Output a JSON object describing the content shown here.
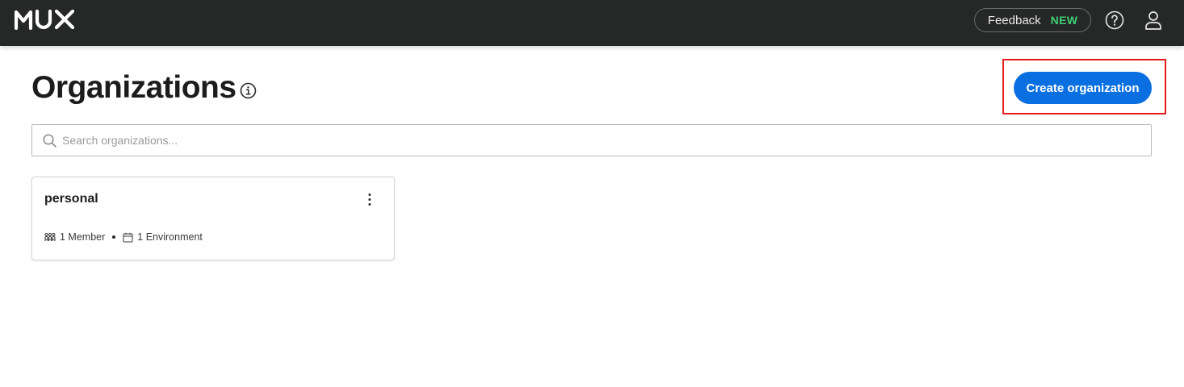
{
  "header": {
    "logo_text": "MUX",
    "feedback_label": "Feedback",
    "feedback_badge": "NEW"
  },
  "page": {
    "title": "Organizations",
    "create_button_label": "Create organization"
  },
  "search": {
    "placeholder": "Search organizations...",
    "value": ""
  },
  "organizations": [
    {
      "name": "personal",
      "members": "1 Member",
      "environments": "1 Environment"
    }
  ],
  "colors": {
    "topbar_bg": "#262727",
    "accent_blue": "#0a6fe0",
    "badge_green": "#3fcf74",
    "highlight_red": "#e31b1b"
  },
  "icons": {
    "help": "question-circle-icon",
    "user": "user-icon",
    "info": "info-icon",
    "search": "search-icon",
    "more": "kebab-menu-icon",
    "members": "members-icon",
    "environments": "calendar-icon"
  }
}
